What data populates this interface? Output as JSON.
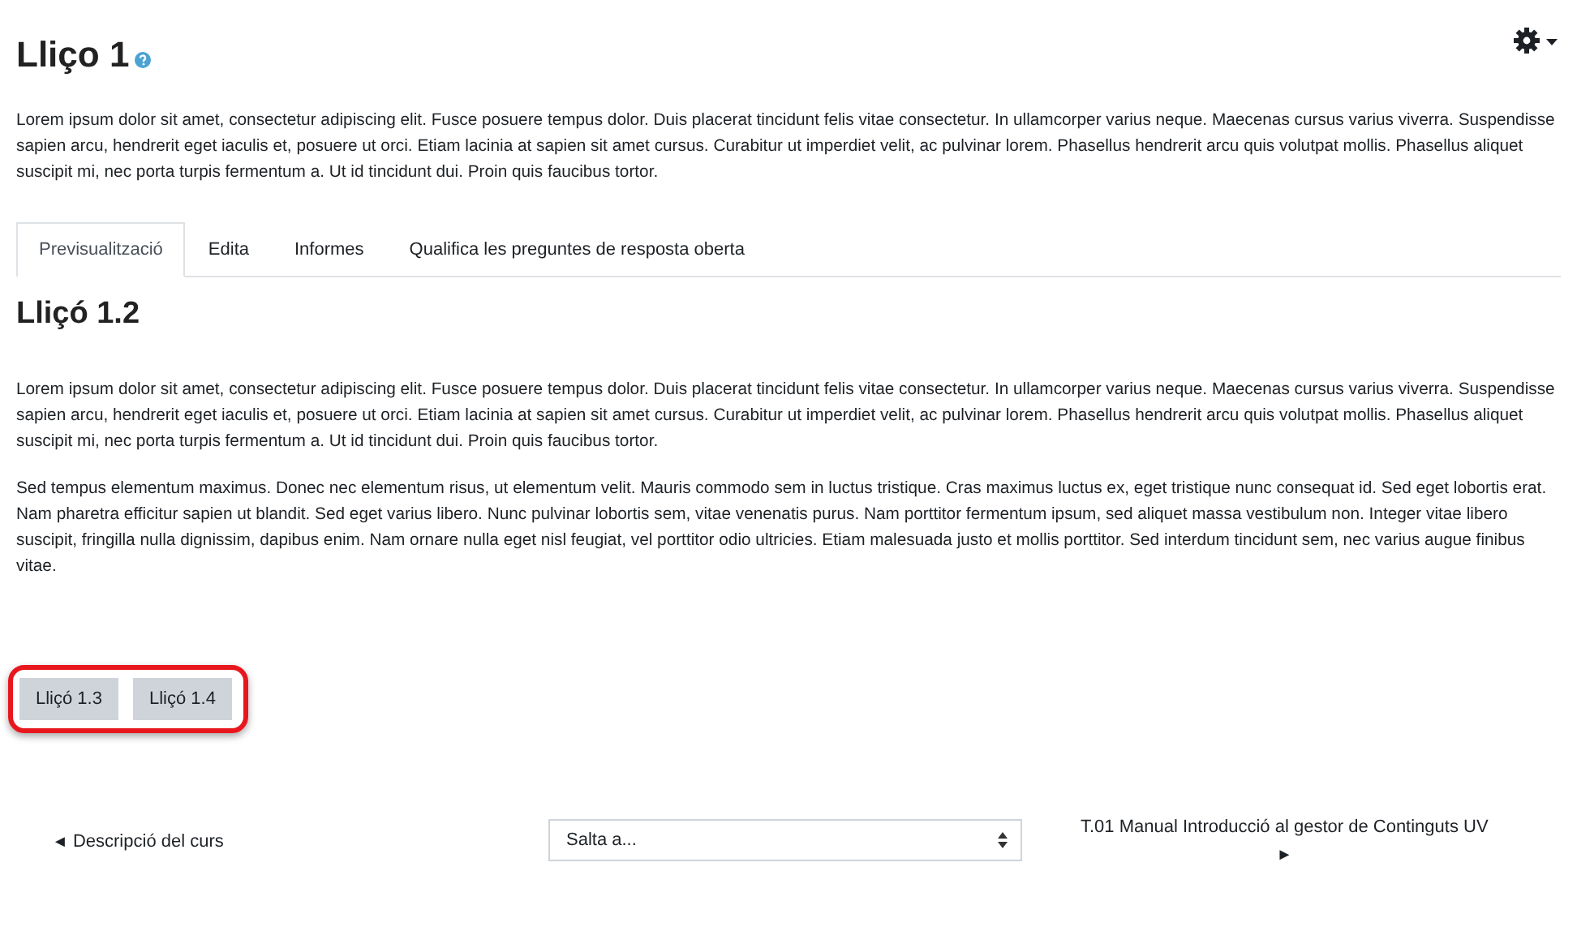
{
  "page_title": "Lliço 1",
  "intro": "Lorem ipsum dolor sit amet, consectetur adipiscing elit. Fusce posuere tempus dolor. Duis placerat tincidunt felis vitae consectetur. In ullamcorper varius neque. Maecenas cursus varius viverra. Suspendisse sapien arcu, hendrerit eget iaculis et, posuere ut orci. Etiam lacinia at sapien sit amet cursus. Curabitur ut imperdiet velit, ac pulvinar lorem. Phasellus hendrerit arcu quis volutpat mollis. Phasellus aliquet suscipit mi, nec porta turpis fermentum a. Ut id tincidunt dui. Proin quis faucibus tortor.",
  "tabs": [
    {
      "label": "Previsualització",
      "selected": true
    },
    {
      "label": "Edita",
      "selected": false
    },
    {
      "label": "Informes",
      "selected": false
    },
    {
      "label": "Qualifica les preguntes de resposta oberta",
      "selected": false
    }
  ],
  "lesson_title": "Lliçó 1.2",
  "paragraphs": [
    "Lorem ipsum dolor sit amet, consectetur adipiscing elit. Fusce posuere tempus dolor. Duis placerat tincidunt felis vitae consectetur. In ullamcorper varius neque. Maecenas cursus varius viverra. Suspendisse sapien arcu, hendrerit eget iaculis et, posuere ut orci. Etiam lacinia at sapien sit amet cursus. Curabitur ut imperdiet velit, ac pulvinar lorem. Phasellus hendrerit arcu quis volutpat mollis. Phasellus aliquet suscipit mi, nec porta turpis fermentum a. Ut id tincidunt dui. Proin quis faucibus tortor.",
    "Sed tempus elementum maximus. Donec nec elementum risus, ut elementum velit. Mauris commodo sem in luctus tristique. Cras maximus luctus ex, eget tristique nunc consequat id. Sed eget lobortis erat. Nam pharetra efficitur sapien ut blandit. Sed eget varius libero. Nunc pulvinar lobortis sem, vitae venenatis purus. Nam porttitor fermentum ipsum, sed aliquet massa vestibulum non. Integer vitae libero suscipit, fringilla nulla dignissim, dapibus enim. Nam ornare nulla eget nisl feugiat, vel porttitor odio ultricies. Etiam malesuada justo et mollis porttitor. Sed interdum tincidunt sem, nec varius augue finibus vitae."
  ],
  "jump_buttons": [
    "Lliçó 1.3",
    "Lliçó 1.4"
  ],
  "nav": {
    "prev_arrow": "◄",
    "prev": "Descripció del curs",
    "jump_placeholder": "Salta a...",
    "next": "T.01 Manual Introducció al gestor de Continguts UV",
    "next_arrow": "►"
  }
}
